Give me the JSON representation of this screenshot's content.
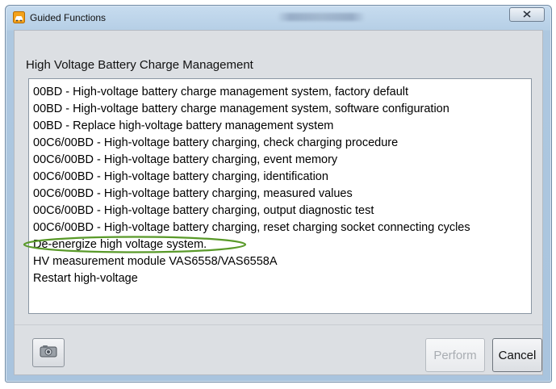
{
  "window": {
    "title": "Guided Functions",
    "close_label": "X"
  },
  "heading": "High Voltage Battery Charge Management",
  "list": {
    "items": [
      "00BD - High-voltage battery charge management system, factory default",
      "00BD - High-voltage battery charge management system, software configuration",
      "00BD - Replace high-voltage battery management system",
      "00C6/00BD - High-voltage battery charging, check charging procedure",
      "00C6/00BD - High-voltage battery charging, event memory",
      "00C6/00BD - High-voltage battery charging, identification",
      "00C6/00BD - High-voltage battery charging, measured values",
      "00C6/00BD - High-voltage battery charging, output diagnostic test",
      "00C6/00BD - High-voltage battery charging, reset charging socket connecting cycles",
      "De-energize high voltage system.",
      "HV measurement module VAS6558/VAS6558A",
      "Restart high-voltage"
    ],
    "highlighted_index": 9,
    "highlight_color": "#5a9a2a"
  },
  "buttons": {
    "perform": "Perform",
    "cancel": "Cancel",
    "camera_icon": "camera-icon"
  },
  "colors": {
    "titlebar": "#b6cfe6",
    "client_bg": "#dcdfe3",
    "disabled_text": "#a9adb2"
  }
}
